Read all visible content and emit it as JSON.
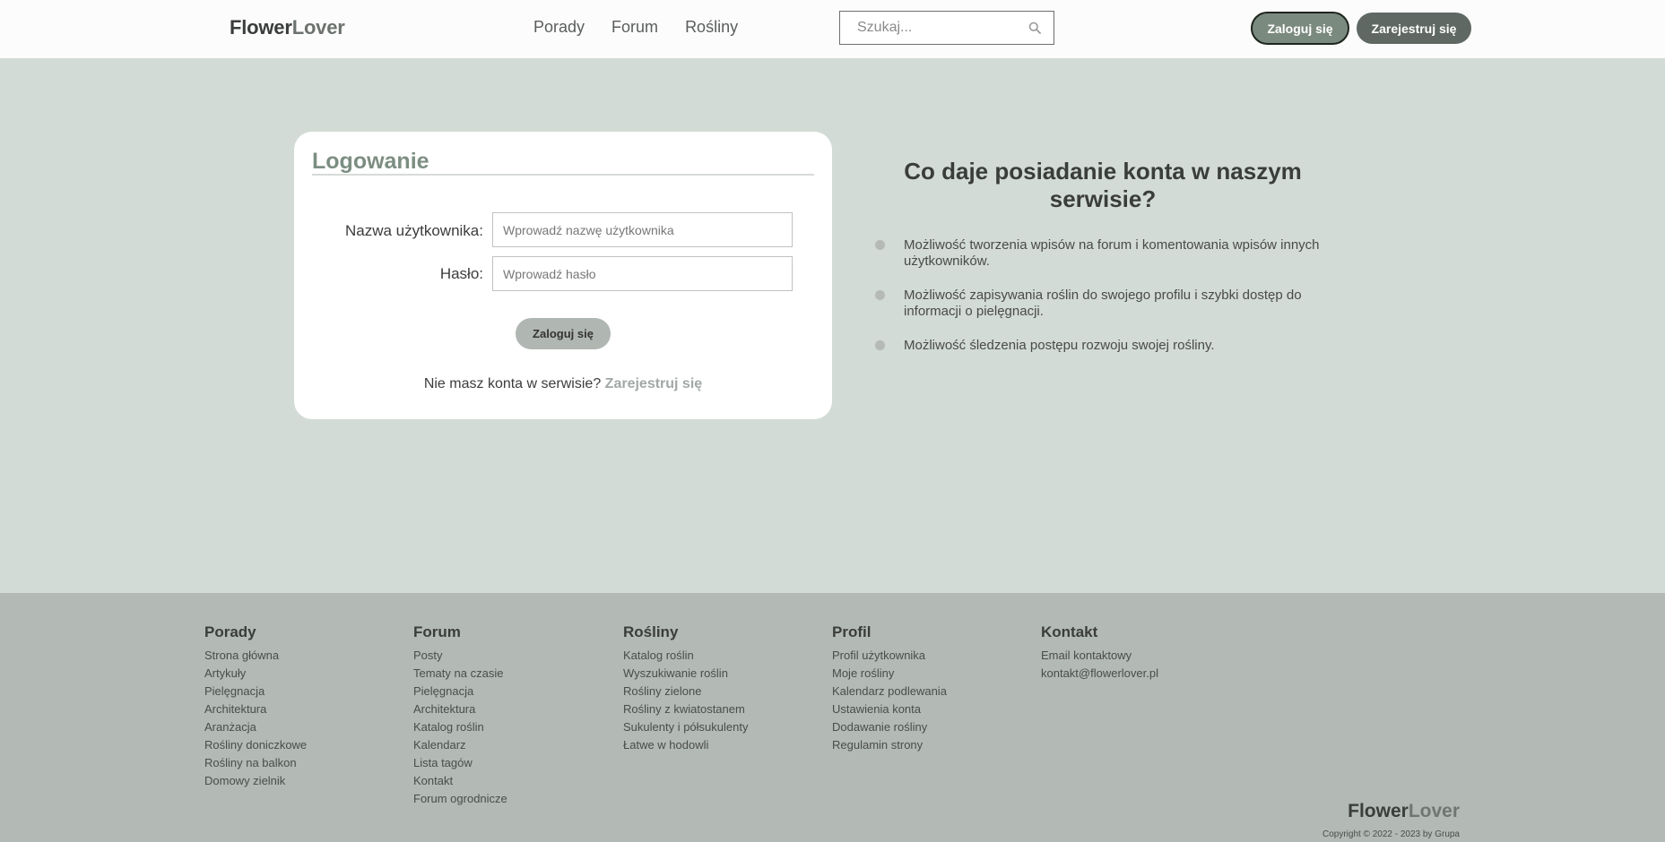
{
  "header": {
    "logo_part1": "Flower",
    "logo_part2": "Lover",
    "nav": [
      "Porady",
      "Forum",
      "Rośliny"
    ],
    "search_placeholder": "Szukaj...",
    "login_label": "Zaloguj się",
    "register_label": "Zarejestruj się"
  },
  "login": {
    "title": "Logowanie",
    "username_label": "Nazwa użytkownika:",
    "username_placeholder": "Wprowadź nazwę użytkownika",
    "password_label": "Hasło:",
    "password_placeholder": "Wprowadź hasło",
    "submit_label": "Zaloguj się",
    "no_account_text": "Nie masz konta w serwisie?",
    "register_link": "Zarejestruj się"
  },
  "benefits": {
    "title": "Co daje posiadanie konta w naszym serwisie?",
    "items": [
      "Możliwość tworzenia wpisów na forum i komentowania wpisów innych użytkowników.",
      "Możliwość zapisywania roślin do swojego profilu i szybki dostęp do informacji o pielęgnacji.",
      "Możliwość śledzenia postępu rozwoju swojej rośliny."
    ]
  },
  "footer": {
    "columns": [
      {
        "title": "Porady",
        "links": [
          "Strona główna",
          "Artykuły",
          "Pielęgnacja",
          "Architektura",
          "Aranżacja",
          "Rośliny doniczkowe",
          "Rośliny na balkon",
          "Domowy zielnik"
        ]
      },
      {
        "title": "Forum",
        "links": [
          "Posty",
          "Tematy na czasie",
          "Pielęgnacja",
          "Architektura",
          "Katalog roślin",
          "Kalendarz",
          "Lista tagów",
          "Kontakt",
          "Forum ogrodnicze"
        ]
      },
      {
        "title": "Rośliny",
        "links": [
          "Katalog roślin",
          "Wyszukiwanie roślin",
          "Rośliny zielone",
          "Rośliny z kwiatostanem",
          "Sukulenty i półsukulenty",
          "Łatwe w hodowli"
        ]
      },
      {
        "title": "Profil",
        "links": [
          "Profil użytkownika",
          "Moje rośliny",
          "Kalendarz podlewania",
          "Ustawienia konta",
          "Dodawanie rośliny",
          "Regulamin strony"
        ]
      },
      {
        "title": "Kontakt",
        "links": [
          "Email kontaktowy",
          "kontakt@flowerlover.pl"
        ]
      }
    ],
    "logo_part1": "Flower",
    "logo_part2": "Lover",
    "copyright": "Copyright © 2022 - 2023 by Grupa"
  },
  "icons": {
    "search": "search-icon",
    "bullet": "bullet-icon"
  },
  "colors": {
    "page_bg": "#d2dbd6",
    "footer_bg": "#b3b9b5",
    "accent": "#7c8e82",
    "button_dark": "#5f6863"
  }
}
